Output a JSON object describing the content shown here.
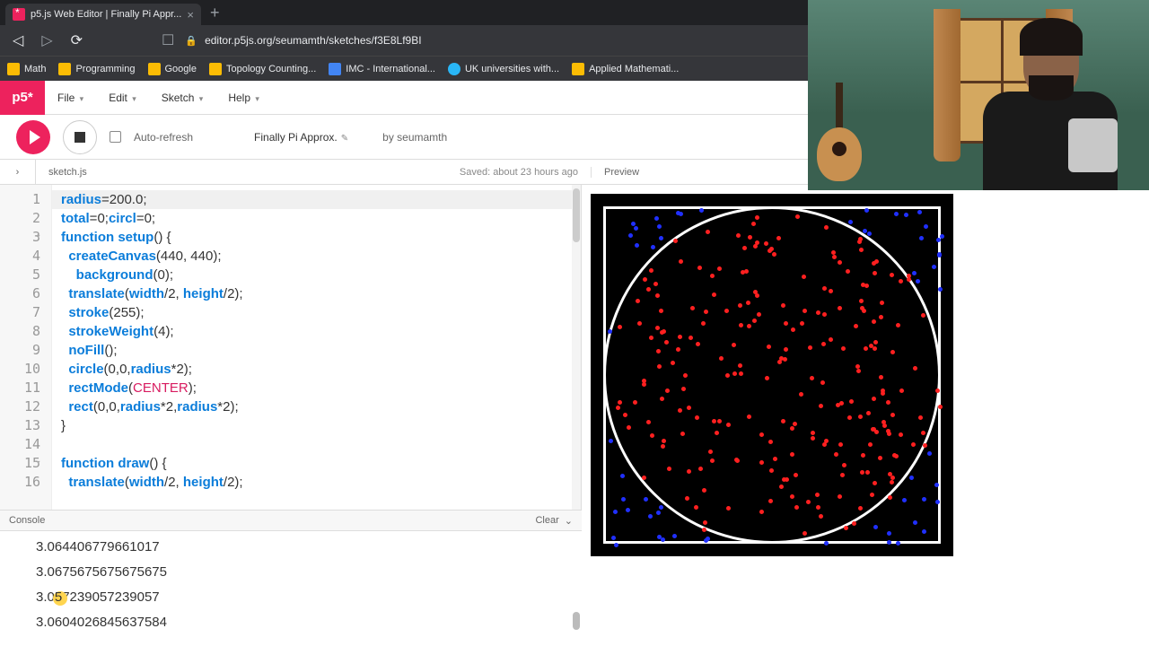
{
  "browser": {
    "tab_title": "p5.js Web Editor | Finally Pi Appr...",
    "url_display": "editor.p5js.org/seumamth/sketches/f3E8Lf9BI",
    "bookmarks": [
      {
        "label": "Math",
        "icon": "folder"
      },
      {
        "label": "Programming",
        "icon": "folder"
      },
      {
        "label": "Google",
        "icon": "folder"
      },
      {
        "label": "Topology Counting...",
        "icon": "folder"
      },
      {
        "label": "IMC - International...",
        "icon": "blue"
      },
      {
        "label": "UK universities with...",
        "icon": "globe"
      },
      {
        "label": "Applied Mathemati...",
        "icon": "folder"
      }
    ]
  },
  "p5": {
    "logo": "p5*",
    "menus": [
      "File",
      "Edit",
      "Sketch",
      "Help"
    ],
    "auto_refresh": "Auto-refresh",
    "sketch_name": "Finally Pi Approx.",
    "by": "by seumamth",
    "file_tab": "sketch.js",
    "saved": "Saved: about 23 hours ago",
    "preview": "Preview"
  },
  "code": {
    "lines": [
      {
        "n": 1,
        "html": "<span class='var'>radius</span>=<span class='num'>200.0</span>;"
      },
      {
        "n": 2,
        "html": "<span class='var'>total</span>=<span class='num'>0</span>;<span class='var'>circl</span>=<span class='num'>0</span>;"
      },
      {
        "n": 3,
        "html": "<span class='kw'>function</span> <span class='fn'>setup</span>() {",
        "fold": true
      },
      {
        "n": 4,
        "html": "  <span class='fn'>createCanvas</span>(<span class='num'>440</span>, <span class='num'>440</span>);"
      },
      {
        "n": 5,
        "html": "    <span class='fn'>background</span>(<span class='num'>0</span>);"
      },
      {
        "n": 6,
        "html": "  <span class='fn'>translate</span>(<span class='var'>width</span>/<span class='num'>2</span>, <span class='var'>height</span>/<span class='num'>2</span>);"
      },
      {
        "n": 7,
        "html": "  <span class='fn'>stroke</span>(<span class='num'>255</span>);"
      },
      {
        "n": 8,
        "html": "  <span class='fn'>strokeWeight</span>(<span class='num'>4</span>);"
      },
      {
        "n": 9,
        "html": "  <span class='fn'>noFill</span>();"
      },
      {
        "n": 10,
        "html": "  <span class='fn'>circle</span>(<span class='num'>0</span>,<span class='num'>0</span>,<span class='var'>radius</span>*<span class='num'>2</span>);"
      },
      {
        "n": 11,
        "html": "  <span class='fn'>rectMode</span>(<span class='const'>CENTER</span>);"
      },
      {
        "n": 12,
        "html": "  <span class='fn'>rect</span>(<span class='num'>0</span>,<span class='num'>0</span>,<span class='var'>radius</span>*<span class='num'>2</span>,<span class='var'>radius</span>*<span class='num'>2</span>);"
      },
      {
        "n": 13,
        "html": "}"
      },
      {
        "n": 14,
        "html": ""
      },
      {
        "n": 15,
        "html": "<span class='kw'>function</span> <span class='fn'>draw</span>() {",
        "fold": true
      },
      {
        "n": 16,
        "html": "  <span class='fn'>translate</span>(<span class='var'>width</span>/<span class='num'>2</span>, <span class='var'>height</span>/<span class='num'>2</span>);"
      }
    ]
  },
  "console": {
    "title": "Console",
    "clear": "Clear",
    "lines": [
      "3.064406779661017",
      "3.0675675675675675",
      "3.057239057239057",
      "3.0604026845637584"
    ]
  }
}
